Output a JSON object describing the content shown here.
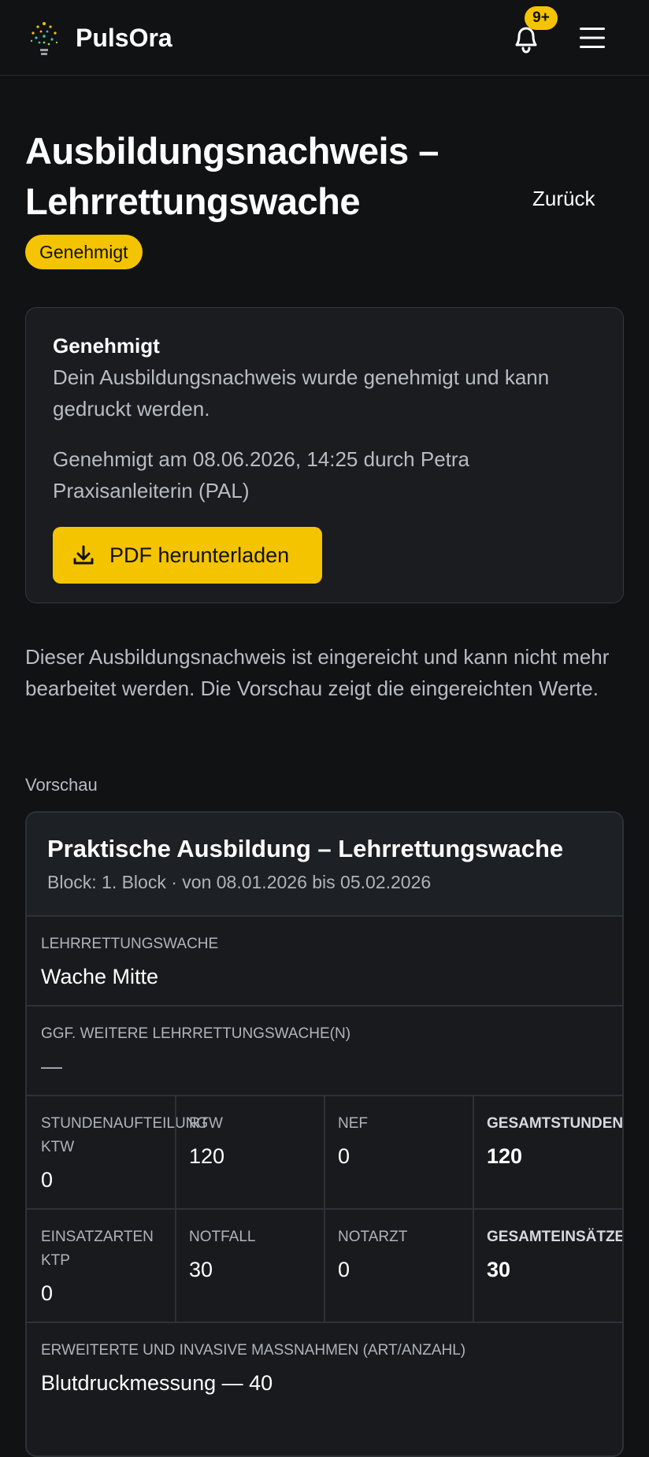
{
  "header": {
    "brand": "PulsOra",
    "notification_count": "9+"
  },
  "page": {
    "title": "Ausbildungsnachweis – Lehrrettungswache",
    "back_label": "Zurück",
    "status": "Genehmigt"
  },
  "approval": {
    "heading": "Genehmigt",
    "text": "Dein Ausbildungsnachweis wurde genehmigt und kann gedruckt werden.",
    "meta": "Genehmigt am 08.06.2026, 14:25 durch Petra Praxisanleiterin (PAL)",
    "download_label": "PDF herunterladen"
  },
  "info": "Dieser Ausbildungsnachweis ist eingereicht und kann nicht mehr bearbeitet werden. Die Vorschau zeigt die eingereichten Werte.",
  "preview": {
    "section_label": "Vorschau",
    "title": "Praktische Ausbildung – Lehrrettungswache",
    "subtitle": "Block: 1. Block · von 08.01.2026 bis 05.02.2026",
    "station": {
      "label": "Lehrrettungswache",
      "value": "Wache Mitte"
    },
    "more_stations": {
      "label": "ggf. weitere Lehrrettungswache(n)",
      "value": "—"
    },
    "hours": {
      "ktw_label": "Stundenaufteilung KTW",
      "ktw_value": "0",
      "rtw_label": "RTW",
      "rtw_value": "120",
      "nef_label": "NEF",
      "nef_value": "0",
      "total_label": "Gesamtstunden",
      "total_value": "120"
    },
    "missions": {
      "ktp_label": "Einsatzarten KTP",
      "ktp_value": "0",
      "notfall_label": "Notfall",
      "notfall_value": "30",
      "notarzt_label": "Notarzt",
      "notarzt_value": "0",
      "total_label": "Gesamteinsätze",
      "total_value": "30"
    },
    "measures": {
      "label": "Erweiterte und invasive Massnahmen (Art/Anzahl)",
      "value": "Blutdruckmessung — 40"
    }
  }
}
